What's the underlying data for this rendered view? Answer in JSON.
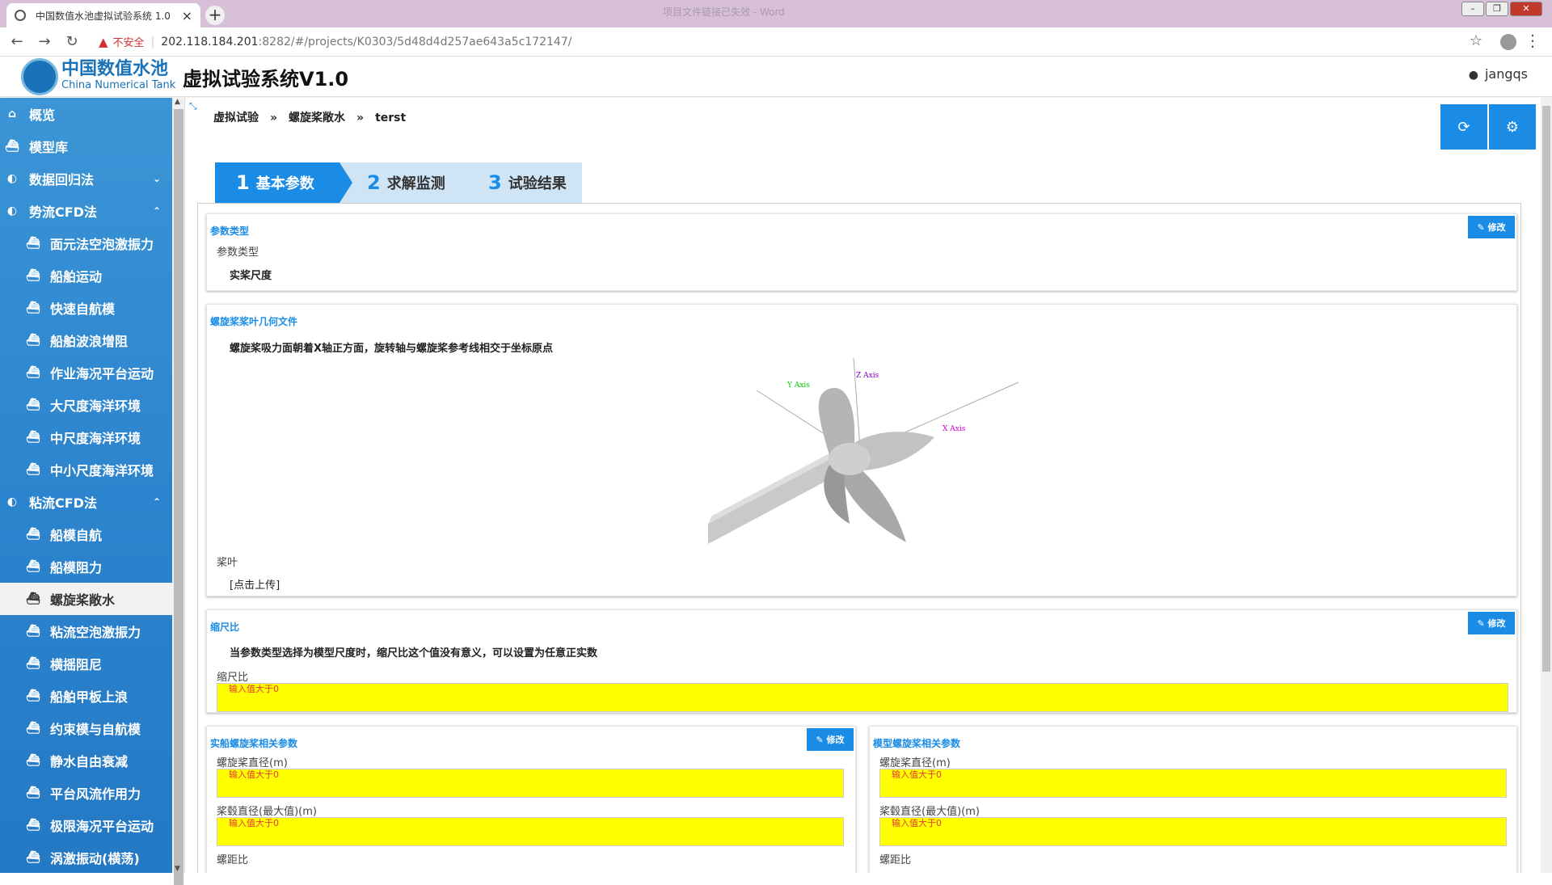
{
  "browser": {
    "tab_title": "中国数值水池虚拟试验系统 1.0",
    "tab_close": "×",
    "new_tab": "+",
    "faint_title": "项目文件链接已失效 - Word",
    "security_label": "不安全",
    "url_host": "202.118.184.201",
    "url_rest": ":8282/#/projects/K0303/5d48d4d257ae643a5c172147/"
  },
  "header": {
    "brand_cn": "中国数值水池",
    "brand_en": "China Numerical Tank",
    "app_title": "虚拟试验系统V1.0",
    "username": "jangqs"
  },
  "sidebar": {
    "items": [
      {
        "label": "概览",
        "icon": "home-icon"
      },
      {
        "label": "模型库",
        "icon": "ship-icon"
      },
      {
        "label": "数据回归法",
        "icon": "dashboard-icon",
        "chevron": "⌄"
      },
      {
        "label": "势流CFD法",
        "icon": "dashboard-icon",
        "chevron": "⌃"
      },
      {
        "label": "面元法空泡激振力",
        "icon": "ship-icon",
        "sub": true
      },
      {
        "label": "船舶运动",
        "icon": "ship-icon",
        "sub": true
      },
      {
        "label": "快速自航模",
        "icon": "ship-icon",
        "sub": true
      },
      {
        "label": "船舶波浪增阻",
        "icon": "ship-icon",
        "sub": true
      },
      {
        "label": "作业海况平台运动",
        "icon": "ship-icon",
        "sub": true
      },
      {
        "label": "大尺度海洋环境",
        "icon": "ship-icon",
        "sub": true
      },
      {
        "label": "中尺度海洋环境",
        "icon": "ship-icon",
        "sub": true
      },
      {
        "label": "中小尺度海洋环境",
        "icon": "ship-icon",
        "sub": true
      },
      {
        "label": "粘流CFD法",
        "icon": "dashboard-icon",
        "chevron": "⌃"
      },
      {
        "label": "船模自航",
        "icon": "ship-icon",
        "sub": true
      },
      {
        "label": "船模阻力",
        "icon": "ship-icon",
        "sub": true
      },
      {
        "label": "螺旋桨敞水",
        "icon": "ship-icon",
        "sub": true,
        "active": true
      },
      {
        "label": "粘流空泡激振力",
        "icon": "ship-icon",
        "sub": true
      },
      {
        "label": "横摇阻尼",
        "icon": "ship-icon",
        "sub": true
      },
      {
        "label": "船舶甲板上浪",
        "icon": "ship-icon",
        "sub": true
      },
      {
        "label": "约束模与自航模",
        "icon": "ship-icon",
        "sub": true
      },
      {
        "label": "静水自由衰减",
        "icon": "ship-icon",
        "sub": true
      },
      {
        "label": "平台风流作用力",
        "icon": "ship-icon",
        "sub": true
      },
      {
        "label": "极限海况平台运动",
        "icon": "ship-icon",
        "sub": true
      },
      {
        "label": "涡激振动(横荡)",
        "icon": "ship-icon",
        "sub": true
      }
    ]
  },
  "breadcrumb": [
    "虚拟试验",
    "螺旋桨敞水",
    "terst"
  ],
  "breadcrumb_sep": "»",
  "steps": [
    {
      "num": "1",
      "label": "基本参数"
    },
    {
      "num": "2",
      "label": "求解监测"
    },
    {
      "num": "3",
      "label": "试验结果"
    }
  ],
  "edit_label": "修改",
  "param_type": {
    "title": "参数类型",
    "label": "参数类型",
    "value": "实桨尺度"
  },
  "geometry": {
    "title": "螺旋桨桨叶几何文件",
    "note": "螺旋桨吸力面朝着X轴正方面，旋转轴与螺旋桨参考线相交于坐标原点",
    "x_axis": "X Axis",
    "y_axis": "Y Axis",
    "z_axis": "Z Axis",
    "blade_label": "桨叶",
    "upload_link": "[点击上传]"
  },
  "scale": {
    "title": "缩尺比",
    "note": "当参数类型选择为模型尺度时，缩尺比这个值没有意义，可以设置为任意正实数",
    "label": "缩尺比",
    "hint": "输入值大于0"
  },
  "real_prop": {
    "title": "实船螺旋桨相关参数",
    "diameter_label": "螺旋桨直径(m)",
    "hub_label": "桨毂直径(最大值)(m)",
    "pitch_label": "螺距比",
    "hint": "输入值大于0"
  },
  "model_prop": {
    "title": "模型螺旋桨相关参数",
    "diameter_label": "螺旋桨直径(m)",
    "hub_label": "桨毂直径(最大值)(m)",
    "pitch_label": "螺距比",
    "hint": "输入值大于0"
  },
  "colors": {
    "accent": "#1a8ce6",
    "sidebar": "#2e86cf",
    "highlight_field": "#ffff00",
    "hint_text": "#e53935"
  }
}
